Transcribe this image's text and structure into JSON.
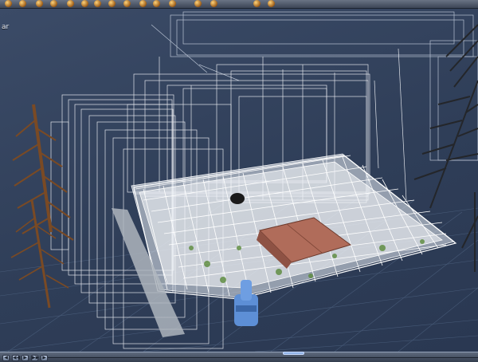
{
  "toolbar": {
    "tool_icons": [
      "move-tool-icon",
      "rotate-tool-icon",
      "scale-tool-icon",
      "select-tool-icon",
      "camera-tool-icon",
      "light-tool-icon",
      "render-tool-icon",
      "material-tool-icon",
      "terrain-tool-icon",
      "sky-tool-icon",
      "object-tool-icon",
      "plant-tool-icon",
      "sphere-tool-icon",
      "cube-tool-icon",
      "settings-tool-icon",
      "help-tool-icon"
    ]
  },
  "viewport": {
    "label": "ar",
    "colors": {
      "background": "#35455f",
      "grid": "#5c7393",
      "wireframe": "#f2f4f8",
      "roof": "#b06c5a",
      "tree": "#7a4a24",
      "figure": "#5d8fd6",
      "path": "#aeb5bd"
    }
  },
  "bottombar": {
    "buttons": [
      "prev-frame-icon",
      "rewind-icon",
      "play-icon",
      "forward-icon",
      "next-frame-icon"
    ],
    "button_glyphs": [
      "◀",
      "◀◀",
      "▶",
      "▶▶",
      "▶"
    ]
  }
}
